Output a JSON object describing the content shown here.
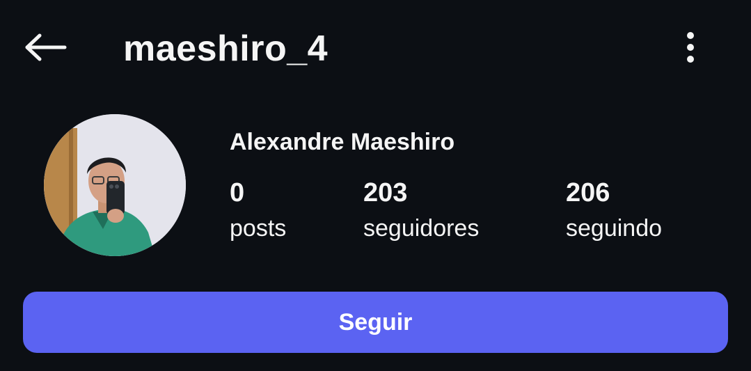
{
  "header": {
    "username": "maeshiro_4",
    "back_icon": "arrow-left-icon",
    "menu_icon": "more-vertical-icon"
  },
  "profile": {
    "full_name": "Alexandre Maeshiro",
    "stats": [
      {
        "value": "0",
        "label": "posts"
      },
      {
        "value": "203",
        "label": "seguidores"
      },
      {
        "value": "206",
        "label": "seguindo"
      }
    ]
  },
  "actions": {
    "follow_label": "Seguir"
  },
  "colors": {
    "background": "#0c0f14",
    "text": "#f5f5f5",
    "accent": "#5b63f2"
  }
}
